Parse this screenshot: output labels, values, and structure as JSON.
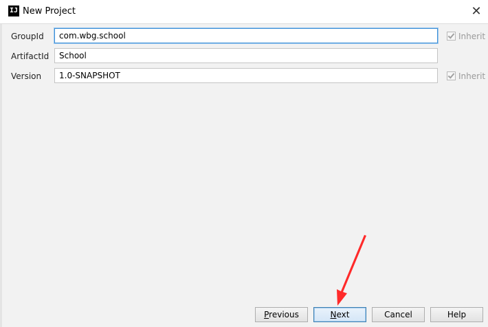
{
  "window": {
    "title": "New Project",
    "app_icon_text": "IJ",
    "close_glyph": "✕"
  },
  "form": {
    "fields": [
      {
        "label": "GroupId",
        "value": "com.wbg.school",
        "inherit_label": "Inherit",
        "has_inherit": true,
        "focused": true
      },
      {
        "label": "ArtifactId",
        "value": "School",
        "has_inherit": false,
        "focused": false
      },
      {
        "label": "Version",
        "value": "1.0-SNAPSHOT",
        "inherit_label": "Inherit",
        "has_inherit": true,
        "focused": false
      }
    ]
  },
  "buttons": {
    "previous": {
      "mnemonic": "P",
      "rest": "revious"
    },
    "next": {
      "mnemonic": "N",
      "rest": "ext"
    },
    "cancel": "Cancel",
    "help": "Help"
  },
  "annotation": {
    "color": "#ff2a2a"
  },
  "colors": {
    "focus_border": "#3d8fd6",
    "background": "#f2f2f2"
  }
}
